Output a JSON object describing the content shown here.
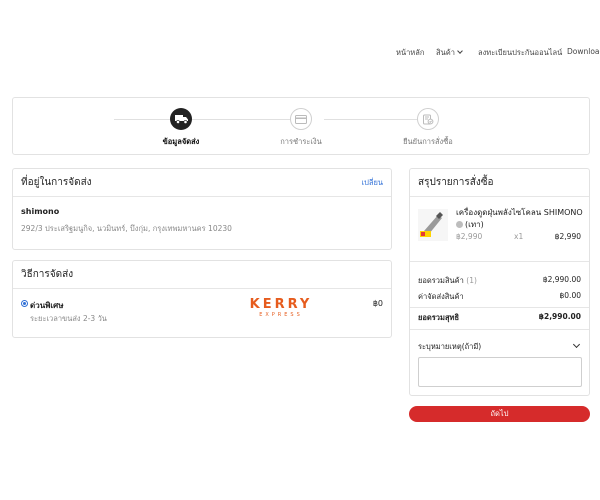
{
  "nav": {
    "home": "หน้าหลัก",
    "products": "สินค้า",
    "warranty": "ลงทะเบียนประกันออนไลน์",
    "download": "Download"
  },
  "stepper": {
    "steps": [
      {
        "label": "ข้อมูลจัดส่ง",
        "icon": "truck-icon",
        "active": true
      },
      {
        "label": "การชำระเงิน",
        "icon": "credit-card-icon",
        "active": false
      },
      {
        "label": "ยืนยันการสั่งซื้อ",
        "icon": "order-confirm-icon",
        "active": false
      }
    ]
  },
  "address": {
    "title": "ที่อยู่ในการจัดส่ง",
    "change_label": "เปลี่ยน",
    "name": "shimono",
    "line": "292/3 ประเสริฐมนูกิจ, นวมินทร์, บึงกุ่ม, กรุงเทพมหานคร 10230"
  },
  "shipping": {
    "title": "วิธีการจัดส่ง",
    "option_name": "ด่วนพิเศษ",
    "option_desc": "ระยะเวลาขนส่ง  2-3  วัน",
    "carrier_logo": "KERRY",
    "carrier_sub": "EXPRESS",
    "price": "฿0",
    "brand_color": "#e65c1e"
  },
  "summary": {
    "title": "สรุปรายการสั่งซื้อ",
    "product_name_1": "เครื่องดูดฝุ่นพลังไซโคลน SHIMONO",
    "product_variant": "(เทา)",
    "unit_price": "฿2,990",
    "qty": "x1",
    "line_total": "฿2,990",
    "subtotal_label": "ยอดรวมสินค้า",
    "subtotal_count": "(1)",
    "subtotal_value": "฿2,990.00",
    "shipping_label": "ค่าจัดส่งสินค้า",
    "shipping_value": "฿0.00",
    "total_label": "ยอดรวมสุทธิ",
    "total_value": "฿2,990.00",
    "note_label": "ระบุหมายเหตุ(ถ้ามี)",
    "next_label": "ถัดไป",
    "accent_color": "#d62b2b"
  }
}
